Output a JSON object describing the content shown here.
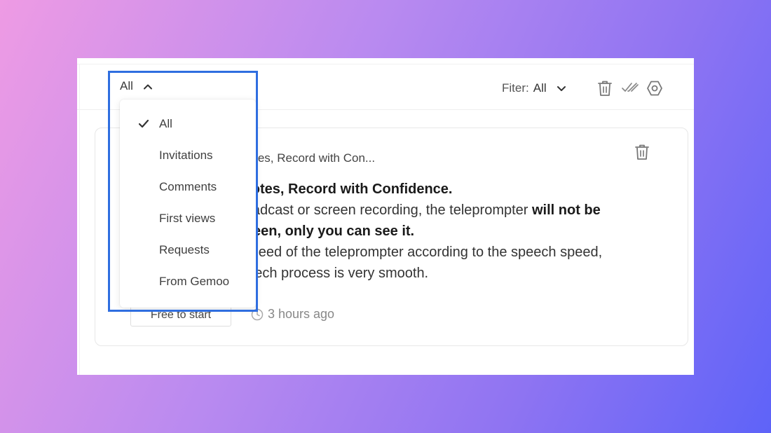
{
  "toolbar": {
    "scope_label": "All",
    "filter_label": "Fiter:",
    "filter_value": "All"
  },
  "icons": {
    "chevron_up": "chevron-up-icon",
    "chevron_down": "chevron-down-icon",
    "trash": "trash-icon",
    "mark_read": "double-check-icon",
    "settings": "settings-icon",
    "check": "check-icon",
    "clock": "clock-icon"
  },
  "dropdown": {
    "items": [
      {
        "label": "All",
        "selected": true
      },
      {
        "label": "Invitations",
        "selected": false
      },
      {
        "label": "Comments",
        "selected": false
      },
      {
        "label": "First views",
        "selected": false
      },
      {
        "label": "Requests",
        "selected": false
      },
      {
        "label": "From Gemoo",
        "selected": false
      }
    ]
  },
  "notification": {
    "title": "r Notes, Record with Con...",
    "body": {
      "line1_bold": "r Notes, Record with Confidence.",
      "line2_a": "broadcast or screen recording, the teleprompter ",
      "line2_b": "will not be",
      "line3_bold": "screen, only you can see it.",
      "line4": "g speed of the teleprompter according to the speech speed,",
      "line5": "speech process is very smooth."
    },
    "cta_label": "Free to start",
    "time": "3 hours ago"
  },
  "colors": {
    "highlight": "#2f6ee0",
    "background_start": "#ee9be4",
    "background_end": "#5e63f8"
  }
}
